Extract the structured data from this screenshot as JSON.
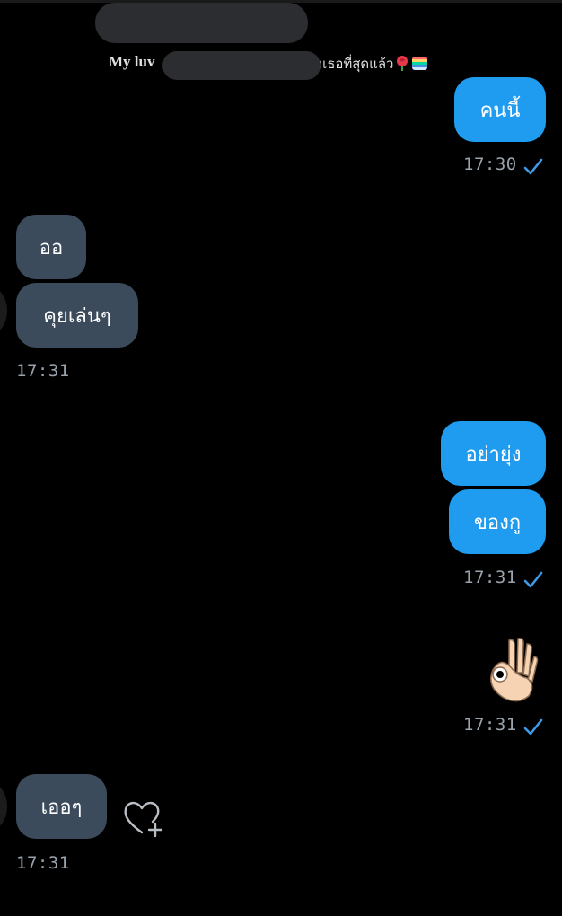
{
  "header": {
    "quote_prefix": "My luv",
    "quote_suffix": "กเธอที่สุดแล้ว"
  },
  "messages": [
    {
      "direction": "out",
      "text": "คนนี้",
      "time": "17:30",
      "status": "sent-check"
    },
    {
      "direction": "in",
      "text": "ออ"
    },
    {
      "direction": "in",
      "text": "คุยเล่นๆ",
      "time": "17:31"
    },
    {
      "direction": "out",
      "text": "อย่ายุ่ง"
    },
    {
      "direction": "out",
      "text": "ของกู",
      "time": "17:31",
      "status": "sent-check"
    },
    {
      "direction": "out",
      "emoji": "ok-hand-icon",
      "time": "17:31",
      "status": "sent-check"
    },
    {
      "direction": "in",
      "text": "เออๆ",
      "time": "17:31",
      "reaction_button": "heart-plus-icon"
    }
  ],
  "colors": {
    "background": "#000000",
    "outgoing_bubble": "#1f9cf0",
    "incoming_bubble": "#3b4b5c",
    "timestamp": "#9aa3ad",
    "check": "#3d9be9"
  }
}
